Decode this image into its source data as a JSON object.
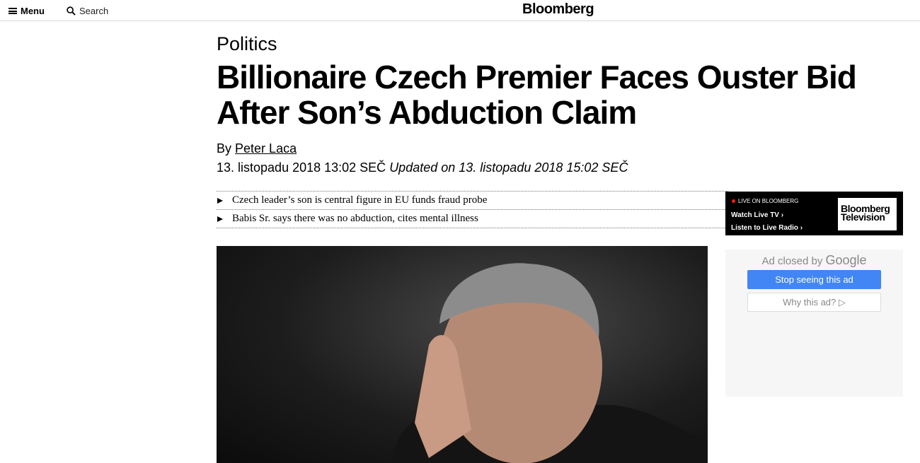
{
  "header": {
    "menu_label": "Menu",
    "search_label": "Search",
    "brand": "Bloomberg"
  },
  "article": {
    "kicker": "Politics",
    "headline": "Billionaire Czech Premier Faces Ouster Bid After Son’s Abduction Claim",
    "byline_prefix": "By",
    "author": "Peter Laca",
    "published": "13. listopadu 2018 13:02 SEČ",
    "updated": "Updated on 13. listopadu 2018 15:02 SEČ",
    "bullets": [
      "Czech leader’s son is central figure in EU funds fraud probe",
      "Babis Sr. says there was no abduction, cites mental illness"
    ]
  },
  "live_promo": {
    "label": "LIVE ON BLOOMBERG",
    "watch": "Watch Live TV",
    "listen": "Listen to Live Radio",
    "logo_line1": "Bloomberg",
    "logo_line2": "Television"
  },
  "ad": {
    "closed_by": "Ad closed by",
    "google": "Google",
    "stop_label": "Stop seeing this ad",
    "why_label": "Why this ad? ▷"
  },
  "colors": {
    "live_dot": "#ee2211",
    "ad_button": "#4285f4"
  }
}
